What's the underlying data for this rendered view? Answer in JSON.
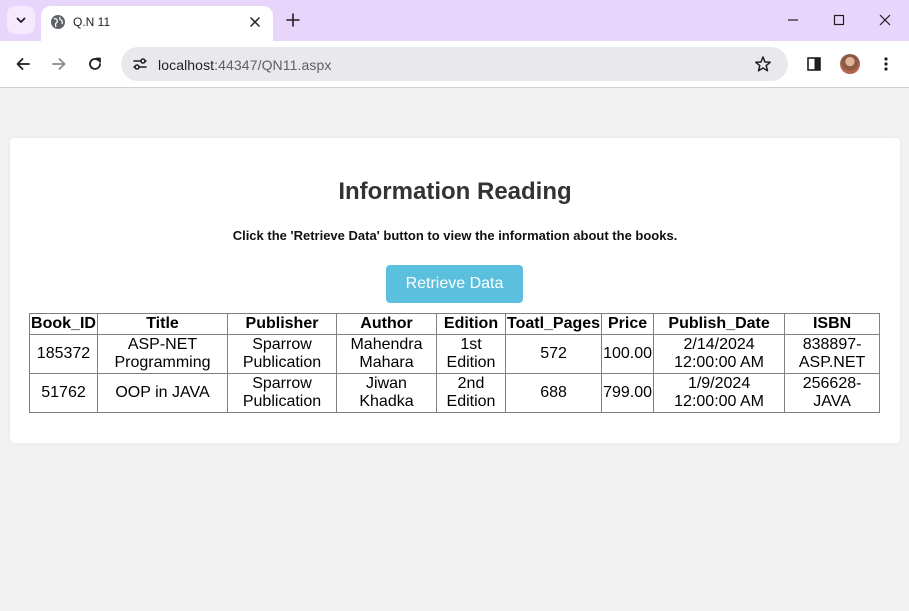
{
  "browser": {
    "tab_title": "Q.N 11",
    "url_host": "localhost",
    "url_path": ":44347/QN11.aspx"
  },
  "page": {
    "heading": "Information Reading",
    "instruction": "Click the 'Retrieve Data' button to view the information about the books.",
    "retrieve_button": "Retrieve Data"
  },
  "table": {
    "headers": [
      "Book_ID",
      "Title",
      "Publisher",
      "Author",
      "Edition",
      "Toatl_Pages",
      "Price",
      "Publish_Date",
      "ISBN"
    ],
    "rows": [
      [
        "185372",
        "ASP-NET Programming",
        "Sparrow Publication",
        "Mahendra Mahara",
        "1st Edition",
        "572",
        "100.00",
        "2/14/2024 12:00:00 AM",
        "838897-ASP.NET"
      ],
      [
        "51762",
        "OOP in JAVA",
        "Sparrow Publication",
        "Jiwan Khadka",
        "2nd Edition",
        "688",
        "799.00",
        "1/9/2024 12:00:00 AM",
        "256628-JAVA"
      ]
    ]
  },
  "colors": {
    "titlebar": "#e8d5fb",
    "button": "#5bc0de",
    "page_background": "#f2f2f2"
  }
}
